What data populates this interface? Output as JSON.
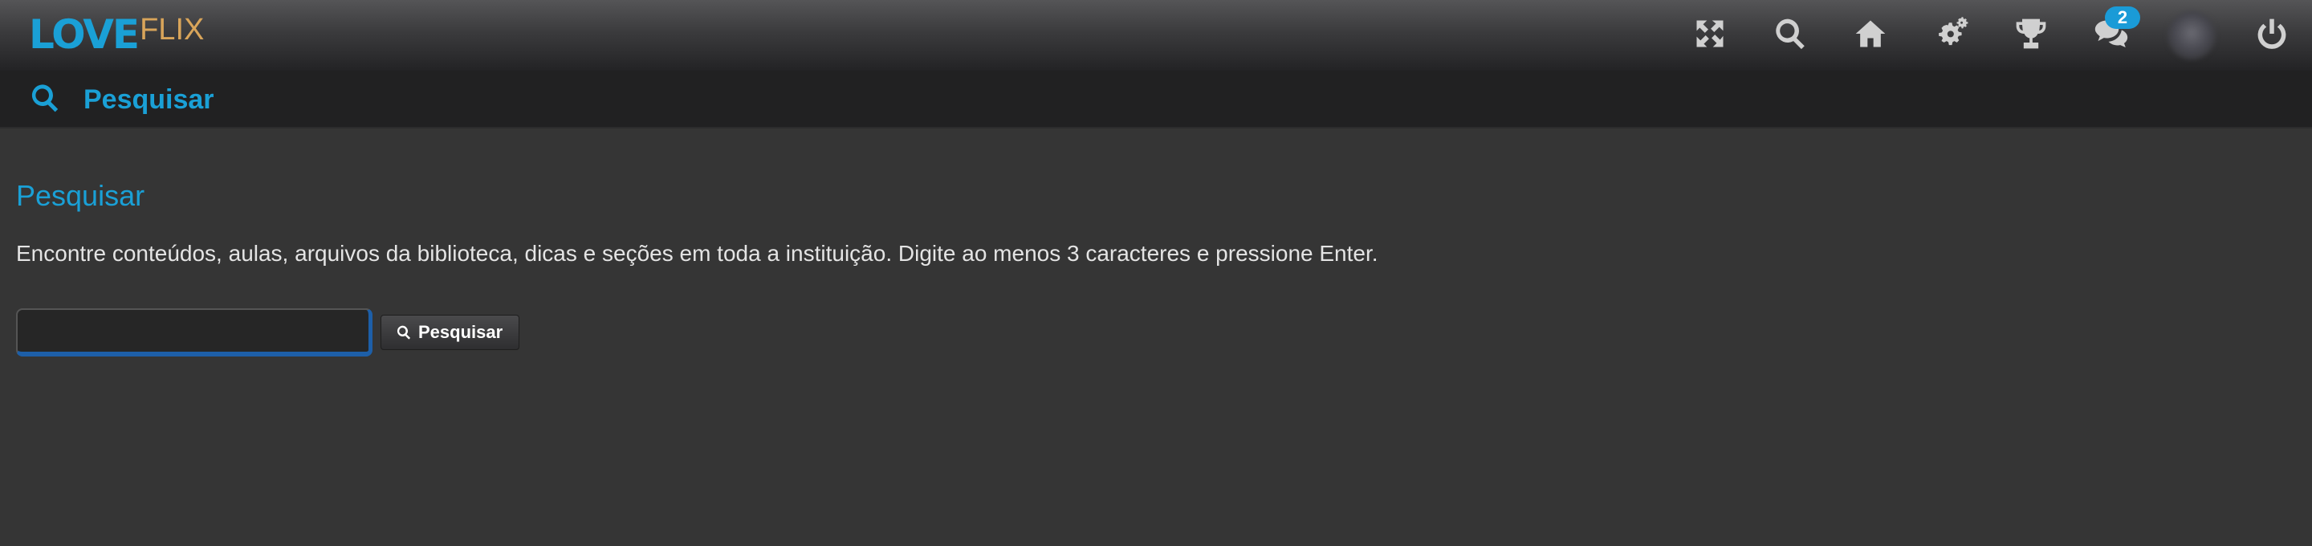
{
  "app": {
    "logo_primary": "LOVE",
    "logo_secondary": "FLIX"
  },
  "topbar": {
    "icons": [
      {
        "name": "fullscreen-icon"
      },
      {
        "name": "search-icon"
      },
      {
        "name": "home-icon"
      },
      {
        "name": "settings-gears-icon"
      },
      {
        "name": "trophy-icon"
      },
      {
        "name": "chat-icon",
        "badge": "2"
      },
      {
        "name": "avatar"
      },
      {
        "name": "power-icon"
      }
    ],
    "chat_badge": "2"
  },
  "subheader": {
    "title": "Pesquisar"
  },
  "main": {
    "title": "Pesquisar",
    "description": "Encontre conteúdos, aulas, arquivos da biblioteca, dicas e seções em toda a instituição. Digite ao menos 3 caracteres e pressione Enter.",
    "search_value": "",
    "search_button_label": "Pesquisar"
  },
  "colors": {
    "accent": "#1aa0d6",
    "logo_secondary": "#d9a55a",
    "background": "#353535",
    "header_dark": "#212122",
    "badge": "#1a9bd7",
    "input_focus": "#1d5fa8"
  }
}
